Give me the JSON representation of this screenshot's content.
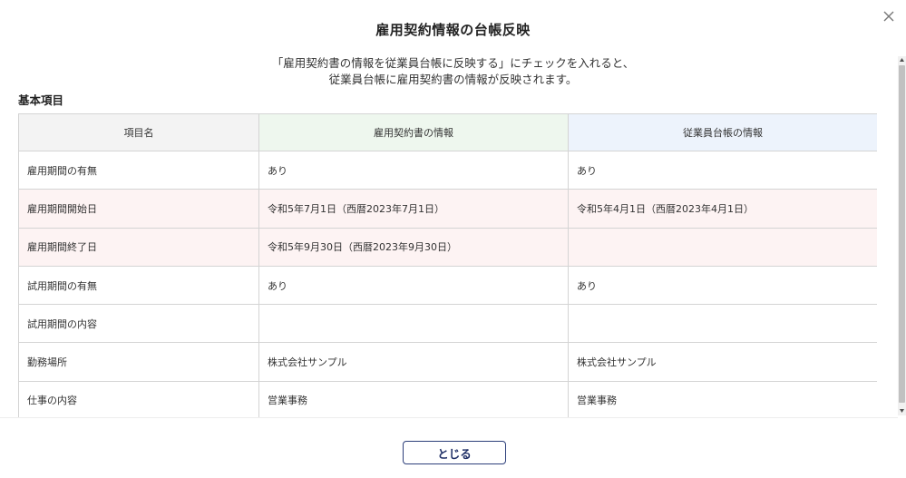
{
  "dialog": {
    "title": "雇用契約情報の台帳反映",
    "description_line1": "「雇用契約書の情報を従業員台帳に反映する」にチェックを入れると、",
    "description_line2": "従業員台帳に雇用契約書の情報が反映されます。",
    "section_title": "基本項目",
    "close_button_label": "とじる"
  },
  "table": {
    "headers": {
      "item": "項目名",
      "contract": "雇用契約書の情報",
      "ledger": "従業員台帳の情報"
    },
    "rows": [
      {
        "item": "雇用期間の有無",
        "contract": "あり",
        "ledger": "あり",
        "highlighted": false
      },
      {
        "item": "雇用期間開始日",
        "contract": "令和5年7月1日（西暦2023年7月1日）",
        "ledger": "令和5年4月1日（西暦2023年4月1日）",
        "highlighted": true
      },
      {
        "item": "雇用期間終了日",
        "contract": "令和5年9月30日（西暦2023年9月30日）",
        "ledger": "",
        "highlighted": true
      },
      {
        "item": "試用期間の有無",
        "contract": "あり",
        "ledger": "あり",
        "highlighted": false
      },
      {
        "item": "試用期間の内容",
        "contract": "",
        "ledger": "",
        "highlighted": false
      },
      {
        "item": "勤務場所",
        "contract": "株式会社サンプル",
        "ledger": "株式会社サンプル",
        "highlighted": false
      },
      {
        "item": "仕事の内容",
        "contract": "営業事務",
        "ledger": "営業事務",
        "highlighted": false
      }
    ]
  },
  "colors": {
    "diff_row": "#fdf3f3",
    "contract_header": "#eef7ee",
    "ledger_header": "#edf3fc",
    "button_border": "#2d3f7a"
  },
  "icons": {
    "close": "close-icon"
  }
}
